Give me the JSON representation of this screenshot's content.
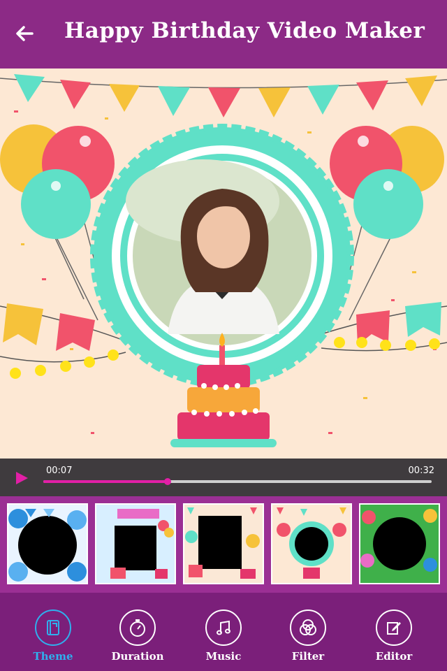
{
  "header": {
    "title": "Happy Birthday Video Maker",
    "back_icon": "arrow-left-icon"
  },
  "player": {
    "current_time": "00:07",
    "total_time": "00:32",
    "progress": 0.32,
    "play_icon": "play-icon"
  },
  "themes": [
    {
      "id": "blue-balloons"
    },
    {
      "id": "happy-birthday-banner"
    },
    {
      "id": "balloons-gifts"
    },
    {
      "id": "teal-frame-cake"
    },
    {
      "id": "green-balloons"
    }
  ],
  "nav": {
    "items": [
      {
        "label": "Theme",
        "icon": "book-icon",
        "active": true
      },
      {
        "label": "Duration",
        "icon": "stopwatch-icon",
        "active": false
      },
      {
        "label": "Music",
        "icon": "music-note-icon",
        "active": false
      },
      {
        "label": "Filter",
        "icon": "filter-circles-icon",
        "active": false
      },
      {
        "label": "Editor",
        "icon": "edit-icon",
        "active": false
      }
    ]
  },
  "colors": {
    "header": "#8c2a86",
    "strip": "#9b2f94",
    "nav": "#7b1f7a",
    "accent": "#e21fa6",
    "active": "#2fb0ee"
  }
}
